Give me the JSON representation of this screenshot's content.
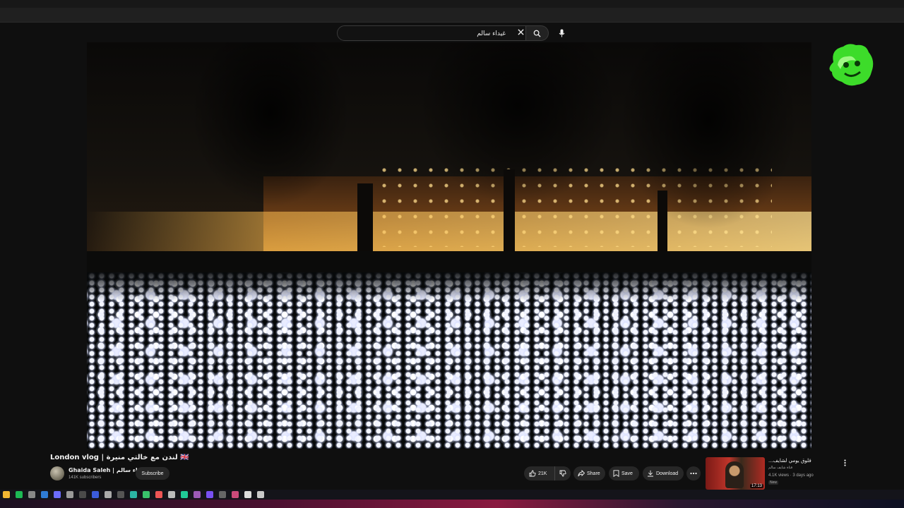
{
  "search": {
    "query": "غيداء سالم"
  },
  "video": {
    "title": "London vlog | لندن مع خالتي منيرة 🇬🇧",
    "channel_name": "Ghaida Saleh | غيداء سالم",
    "subscribers": "141K subscribers",
    "subscribe_label": "Subscribe",
    "likes": "21K",
    "share_label": "Share",
    "save_label": "Save",
    "download_label": "Download"
  },
  "recommendation": {
    "title": "فلوق يومي لشايف...",
    "channel": "قناة شايف سالم",
    "meta": "4.1K views · 3 days ago",
    "badge": "New",
    "duration": "17:13"
  },
  "colors": {
    "ghost": "#3ddc2a",
    "accent": "#ff0033",
    "pill_bg": "#272727"
  },
  "icons": [
    "search-icon",
    "close-icon",
    "mic-icon",
    "like-icon",
    "dislike-icon",
    "share-icon",
    "save-icon",
    "download-icon",
    "more-icon"
  ]
}
